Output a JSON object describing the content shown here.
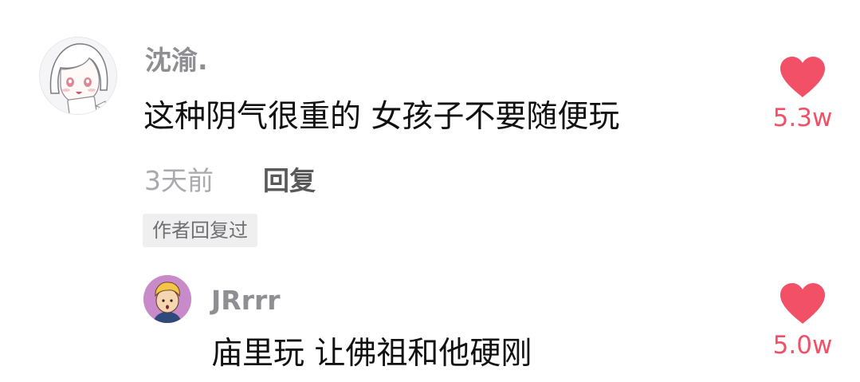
{
  "comment": {
    "username": "沈渝.",
    "text": "这种阴气很重的 女孩子不要随便玩",
    "time": "3天前",
    "reply_label": "回复",
    "author_badge": "作者回复过",
    "likes": "5.3w",
    "avatar_icon": "anime-girl-avatar"
  },
  "reply": {
    "username": "JRrrr",
    "text": "庙里玩 让佛祖和他硬刚",
    "likes": "5.0w",
    "avatar_icon": "cartoon-boy-avatar"
  },
  "colors": {
    "like_red": "#f25066",
    "username_gray": "#8e8e93",
    "badge_bg": "#efefef"
  }
}
